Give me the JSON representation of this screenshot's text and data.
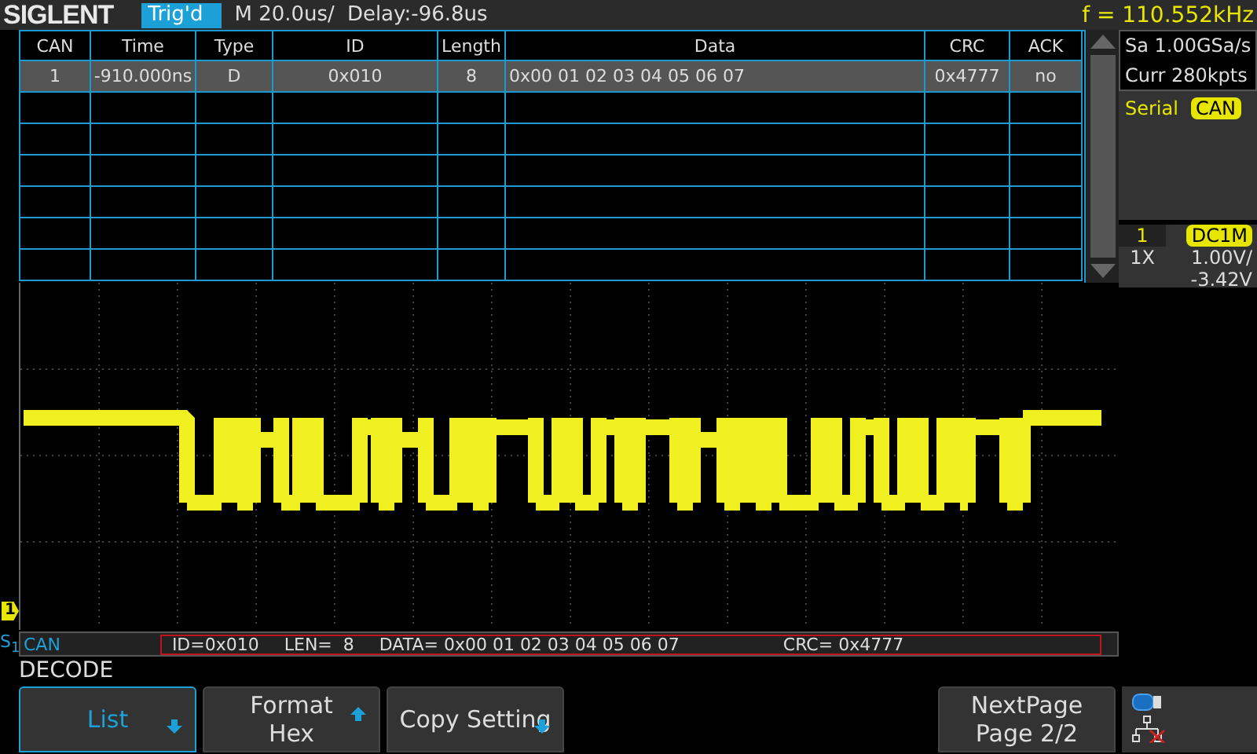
{
  "brand": "SIGLENT",
  "trigger_status": "Trig'd",
  "timebase": "M 20.0us/",
  "delay": "Delay:-96.8us",
  "frequency": "f = 110.552kHz",
  "table": {
    "columns": [
      "CAN",
      "Time",
      "Type",
      "ID",
      "Length",
      "Data",
      "CRC",
      "ACK"
    ],
    "rows": [
      {
        "selected": true,
        "cells": [
          "1",
          "-910.000ns",
          "D",
          "0x010",
          "8",
          "0x00 01 02 03 04 05 06 07",
          "0x4777",
          "no"
        ]
      }
    ]
  },
  "acquisition": {
    "sample_rate": "Sa 1.00GSa/s",
    "memory_depth": "Curr 280kpts"
  },
  "trigger_type": {
    "label": "Serial",
    "value": "CAN"
  },
  "channel": {
    "number": "1",
    "coupling": "DC1M",
    "probe": "1X",
    "scale": "1.00V/",
    "offset": "-3.42V"
  },
  "channel_marker": "1",
  "bus": {
    "prefix": "S",
    "index": "1",
    "name": "CAN",
    "fields": [
      "ID=0x010",
      "LEN=  8",
      "DATA= 0x00 01 02 03 04 05 06 07",
      "CRC= 0x4777"
    ]
  },
  "menu": {
    "title": "DECODE",
    "buttons": [
      {
        "kind": "dropdown",
        "label": "List",
        "selected": true
      },
      {
        "kind": "toggle",
        "label": "Format",
        "value": "Hex",
        "selected": false
      },
      {
        "kind": "dropdown",
        "label": "Copy Setting",
        "selected": false
      },
      {
        "kind": "blank"
      },
      {
        "kind": "blank"
      },
      {
        "kind": "action",
        "label": "NextPage",
        "value": "Page 2/2",
        "selected": false
      }
    ]
  }
}
